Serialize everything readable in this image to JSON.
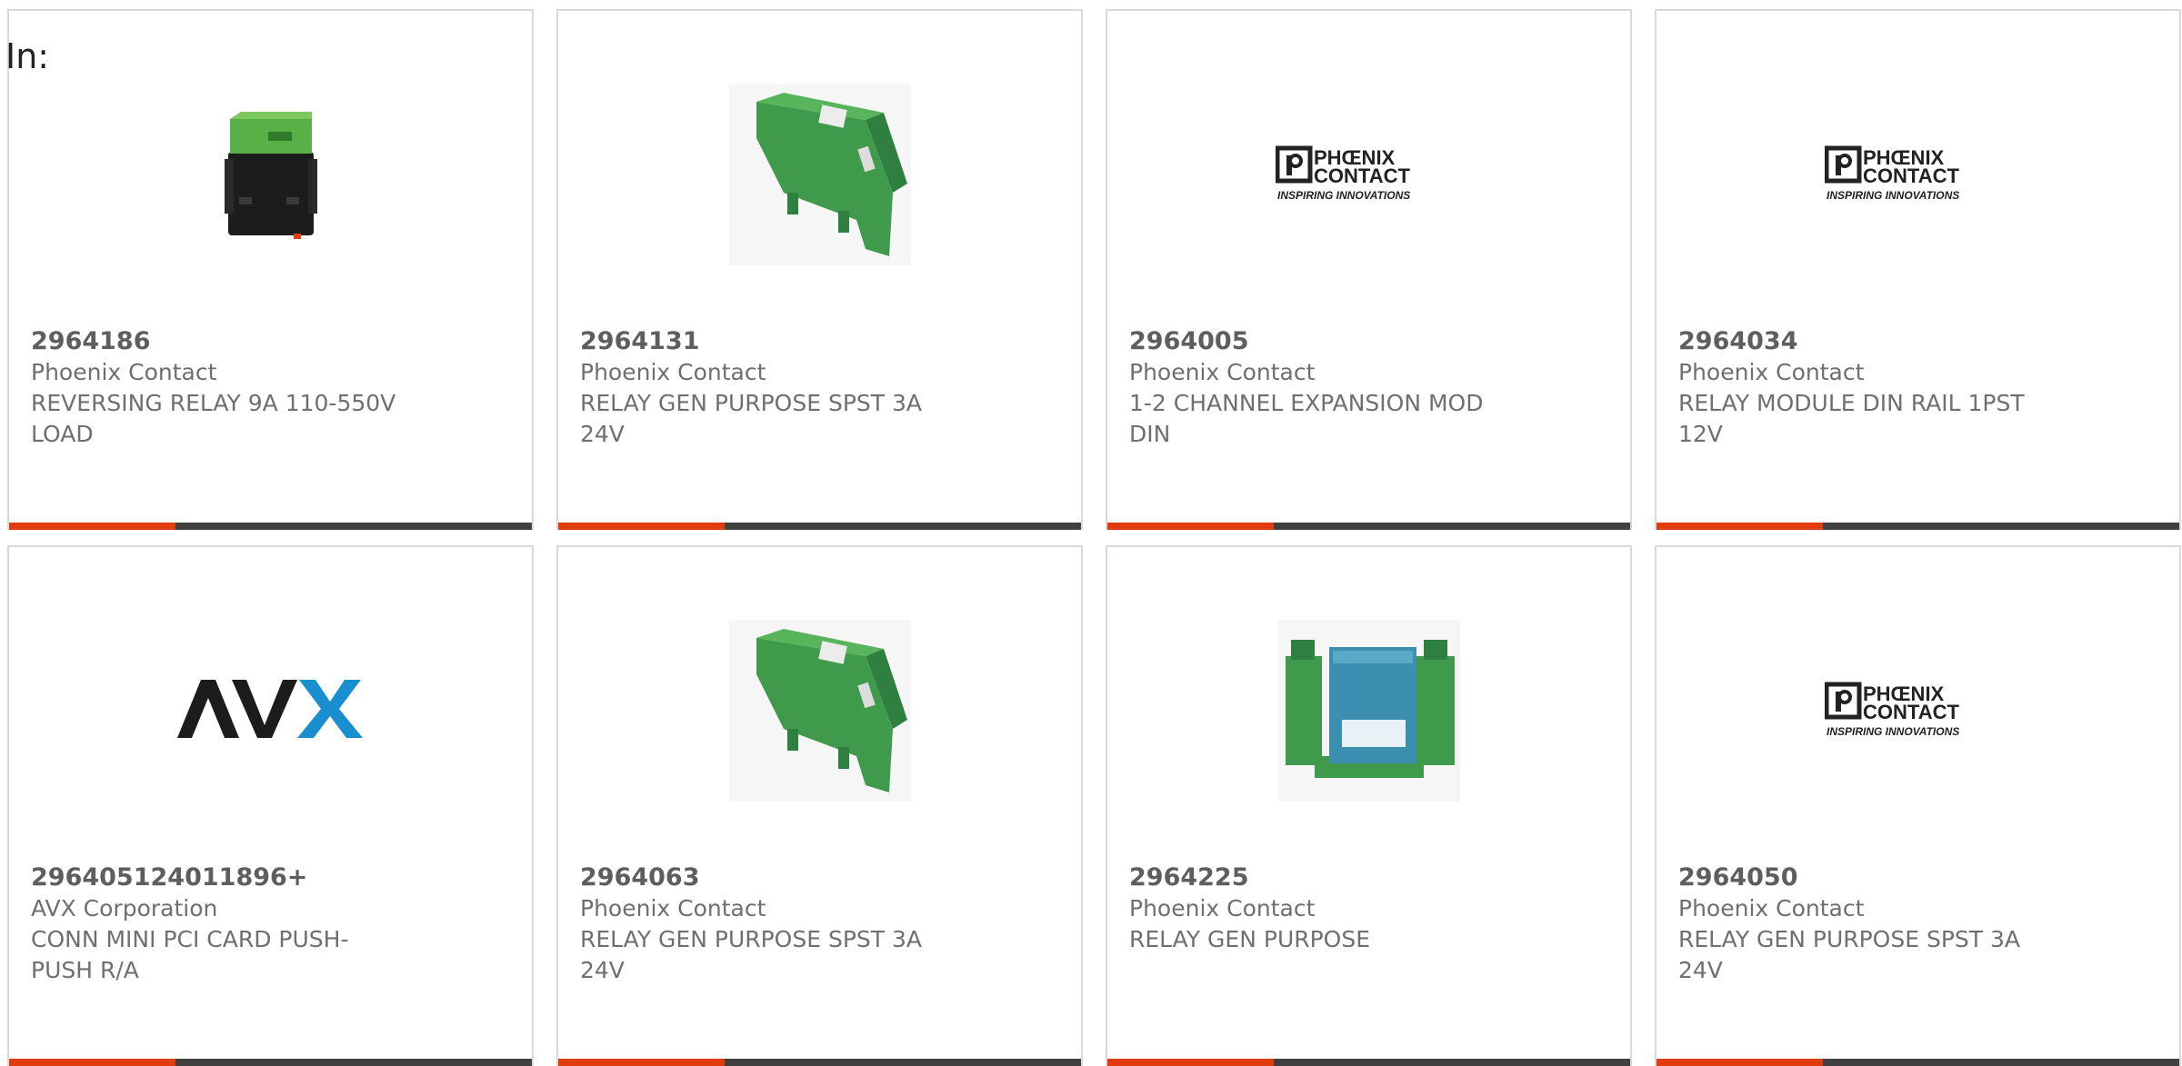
{
  "header": {
    "in_label": "In:"
  },
  "colors": {
    "accent": "#e03c10",
    "bar": "#404040",
    "avx_blue": "#1a8fd0",
    "relay_green": "#3e9a55"
  },
  "cards": [
    {
      "part_number": "2964186",
      "manufacturer": "Phoenix Contact",
      "description_line1": "REVERSING RELAY 9A 110-550V",
      "description_line2": "LOAD",
      "image": "relay-photo-black-green",
      "logo_tagline": ""
    },
    {
      "part_number": "2964131",
      "manufacturer": "Phoenix Contact",
      "description_line1": "RELAY GEN PURPOSE SPST 3A",
      "description_line2": "24V",
      "image": "din-relay-photo",
      "logo_tagline": ""
    },
    {
      "part_number": "2964005",
      "manufacturer": "Phoenix Contact",
      "description_line1": "1-2 CHANNEL EXPANSION MOD",
      "description_line2": "DIN",
      "image": "phoenix-contact-logo",
      "logo_tagline": "INSPIRING INNOVATIONS"
    },
    {
      "part_number": "2964034",
      "manufacturer": "Phoenix Contact",
      "description_line1": "RELAY MODULE DIN RAIL 1PST",
      "description_line2": "12V",
      "image": "phoenix-contact-logo",
      "logo_tagline": "INSPIRING INNOVATIONS"
    },
    {
      "part_number": "296405124011896+",
      "manufacturer": "AVX Corporation",
      "description_line1": "CONN MINI PCI CARD PUSH-",
      "description_line2": "PUSH R/A",
      "image": "avx-logo",
      "logo_tagline": ""
    },
    {
      "part_number": "2964063",
      "manufacturer": "Phoenix Contact",
      "description_line1": "RELAY GEN PURPOSE SPST 3A",
      "description_line2": "24V",
      "image": "din-relay-photo",
      "logo_tagline": ""
    },
    {
      "part_number": "2964225",
      "manufacturer": "Phoenix Contact",
      "description_line1": "RELAY GEN PURPOSE",
      "description_line2": "",
      "image": "relay-base-photo",
      "logo_tagline": ""
    },
    {
      "part_number": "2964050",
      "manufacturer": "Phoenix Contact",
      "description_line1": "RELAY GEN PURPOSE SPST 3A",
      "description_line2": "24V",
      "image": "phoenix-contact-logo",
      "logo_tagline": "INSPIRING INNOVATIONS"
    }
  ]
}
